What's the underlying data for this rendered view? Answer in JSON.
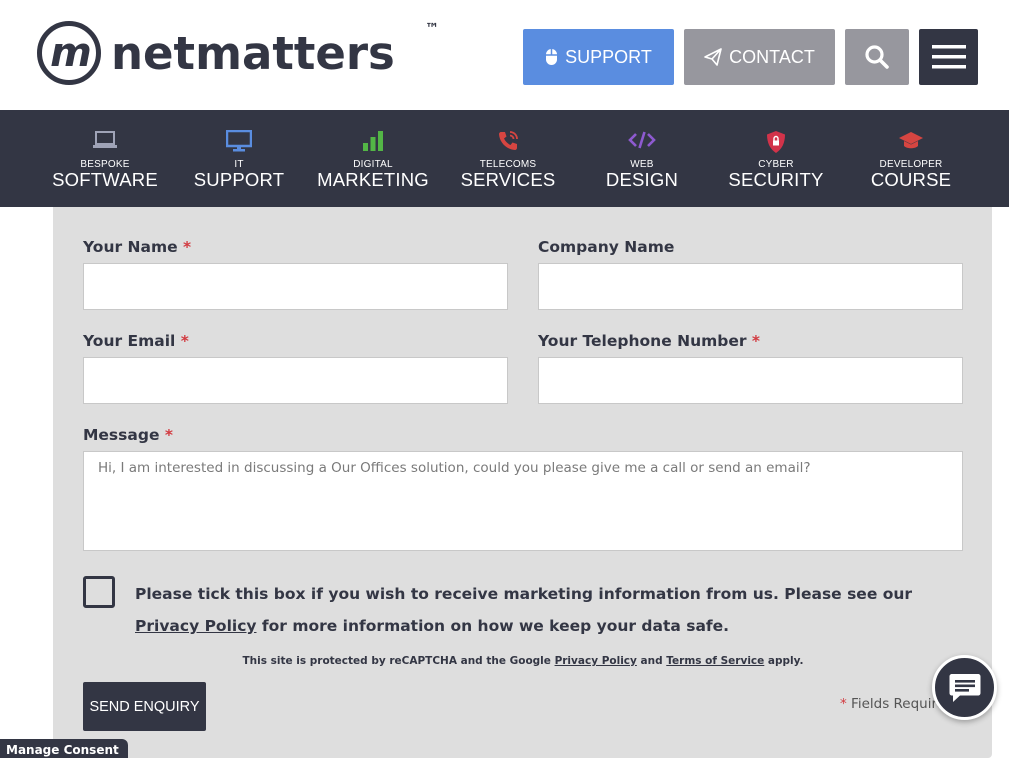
{
  "header": {
    "logo_text": "netmatters",
    "logo_mark": "m",
    "logo_tm": "™",
    "support_label": "SUPPORT",
    "contact_label": "CONTACT",
    "search_icon": "search-icon",
    "menu_icon": "hamburger-menu-icon"
  },
  "nav": {
    "items": [
      {
        "small": "BESPOKE",
        "big": "SOFTWARE",
        "icon": "laptop-icon",
        "color": "#9fa3b7"
      },
      {
        "small": "IT",
        "big": "SUPPORT",
        "icon": "monitor-icon",
        "color": "#5a8de0"
      },
      {
        "small": "DIGITAL",
        "big": "MARKETING",
        "icon": "bar-chart-icon",
        "color": "#53b646"
      },
      {
        "small": "TELECOMS",
        "big": "SERVICES",
        "icon": "phone-icon",
        "color": "#d64541"
      },
      {
        "small": "WEB",
        "big": "DESIGN",
        "icon": "code-icon",
        "color": "#8e5ad0"
      },
      {
        "small": "CYBER",
        "big": "SECURITY",
        "icon": "shield-icon",
        "color": "#d2334a"
      },
      {
        "small": "DEVELOPER",
        "big": "COURSE",
        "icon": "graduation-cap-icon",
        "color": "#d64541"
      }
    ]
  },
  "form": {
    "name_label": "Your Name",
    "company_label": "Company Name",
    "email_label": "Your Email",
    "phone_label": "Your Telephone Number",
    "message_label": "Message",
    "required_mark": "*",
    "message_placeholder": "Hi, I am interested in discussing a Our Offices solution, could you please give me a call or send an email?",
    "consent_text_1": "Please tick this box if you wish to receive marketing information from us. Please see our ",
    "consent_link": "Privacy Policy",
    "consent_text_2": " for more information on how we keep your data safe.",
    "recaptcha_1": "This site is protected by reCAPTCHA and the Google ",
    "recaptcha_privacy": "Privacy Policy",
    "recaptcha_and": " and ",
    "recaptcha_terms": "Terms of Service",
    "recaptcha_2": " apply.",
    "send_label": "SEND ENQUIRY",
    "fields_required": "Fields Required"
  },
  "chat_icon": "chat-icon",
  "manage_consent": "Manage Consent",
  "colors": {
    "dark": "#333644",
    "support_blue": "#5a8de0",
    "grey_button": "#97979e",
    "required_red": "#d23a40",
    "panel": "#dedede"
  }
}
